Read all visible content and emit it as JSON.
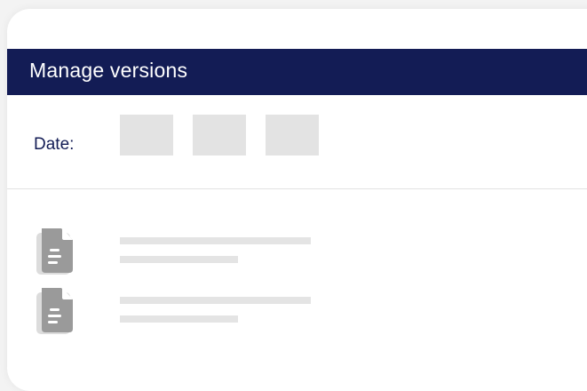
{
  "panel": {
    "title": "Manage versions"
  },
  "date_filter": {
    "label": "Date:",
    "fields": [
      {
        "value": ""
      },
      {
        "value": ""
      },
      {
        "value": ""
      }
    ]
  },
  "versions": [
    {
      "icon": "document-icon",
      "name": "",
      "detail": ""
    },
    {
      "icon": "document-icon",
      "name": "",
      "detail": ""
    }
  ],
  "colors": {
    "header_bg": "#131c55",
    "header_text": "#ffffff",
    "label_text": "#131c55",
    "placeholder_fill": "#e3e3e3",
    "icon_fill": "#9a9a9a"
  }
}
